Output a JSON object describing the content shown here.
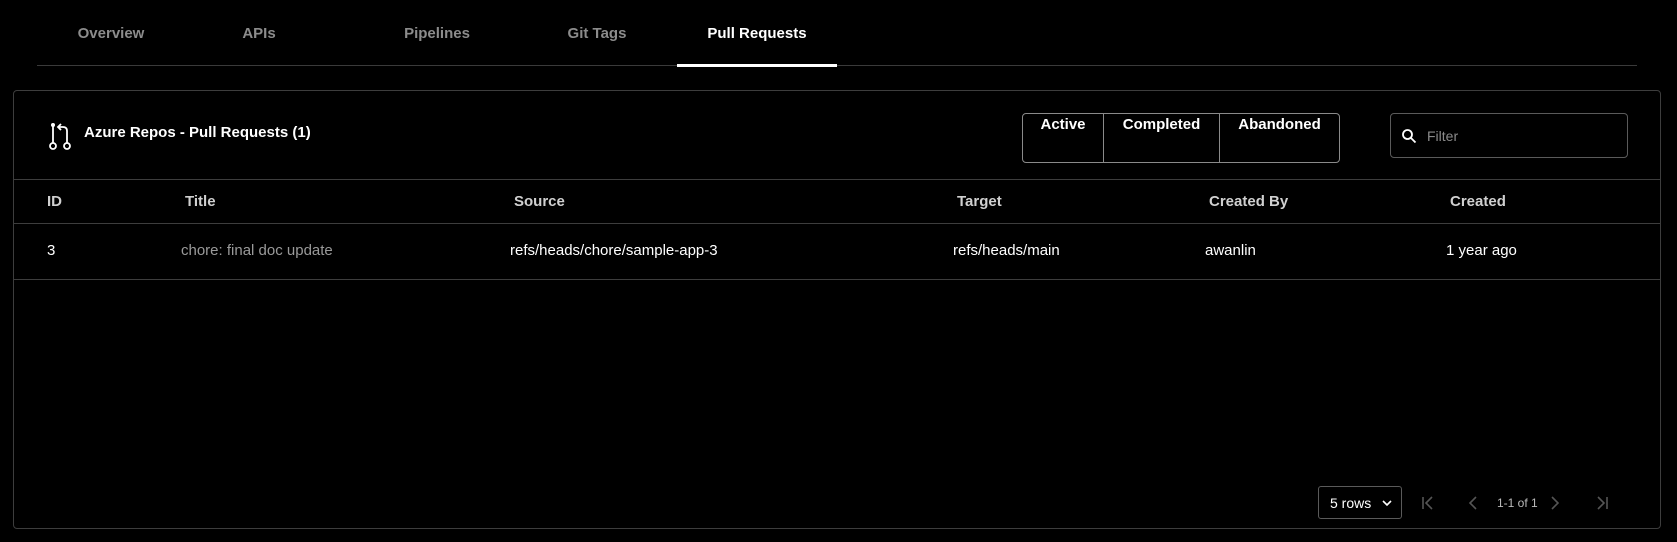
{
  "tabs": [
    {
      "label": "Overview",
      "active": false
    },
    {
      "label": "APIs",
      "active": false
    },
    {
      "label": "Pipelines",
      "active": false
    },
    {
      "label": "Git Tags",
      "active": false
    },
    {
      "label": "Pull Requests",
      "active": true
    }
  ],
  "card": {
    "title": "Azure Repos - Pull Requests (1)",
    "icon": "pull-request-icon",
    "status_filters": [
      "Active",
      "Completed",
      "Abandoned"
    ],
    "filter": {
      "placeholder": "Filter",
      "value": "",
      "icon": "search-icon"
    }
  },
  "table": {
    "columns": [
      "ID",
      "Title",
      "Source",
      "Target",
      "Created By",
      "Created"
    ],
    "rows": [
      {
        "id": "3",
        "title": "chore: final doc update",
        "source": "refs/heads/chore/sample-app-3",
        "target": "refs/heads/main",
        "created_by": "awanlin",
        "created": "1 year ago"
      }
    ]
  },
  "pagination": {
    "rows_per_page": "5 rows",
    "info": "1-1 of 1"
  },
  "colors": {
    "background": "#000000",
    "border": "#3d3d3d",
    "muted_text": "#8c8c8c"
  }
}
